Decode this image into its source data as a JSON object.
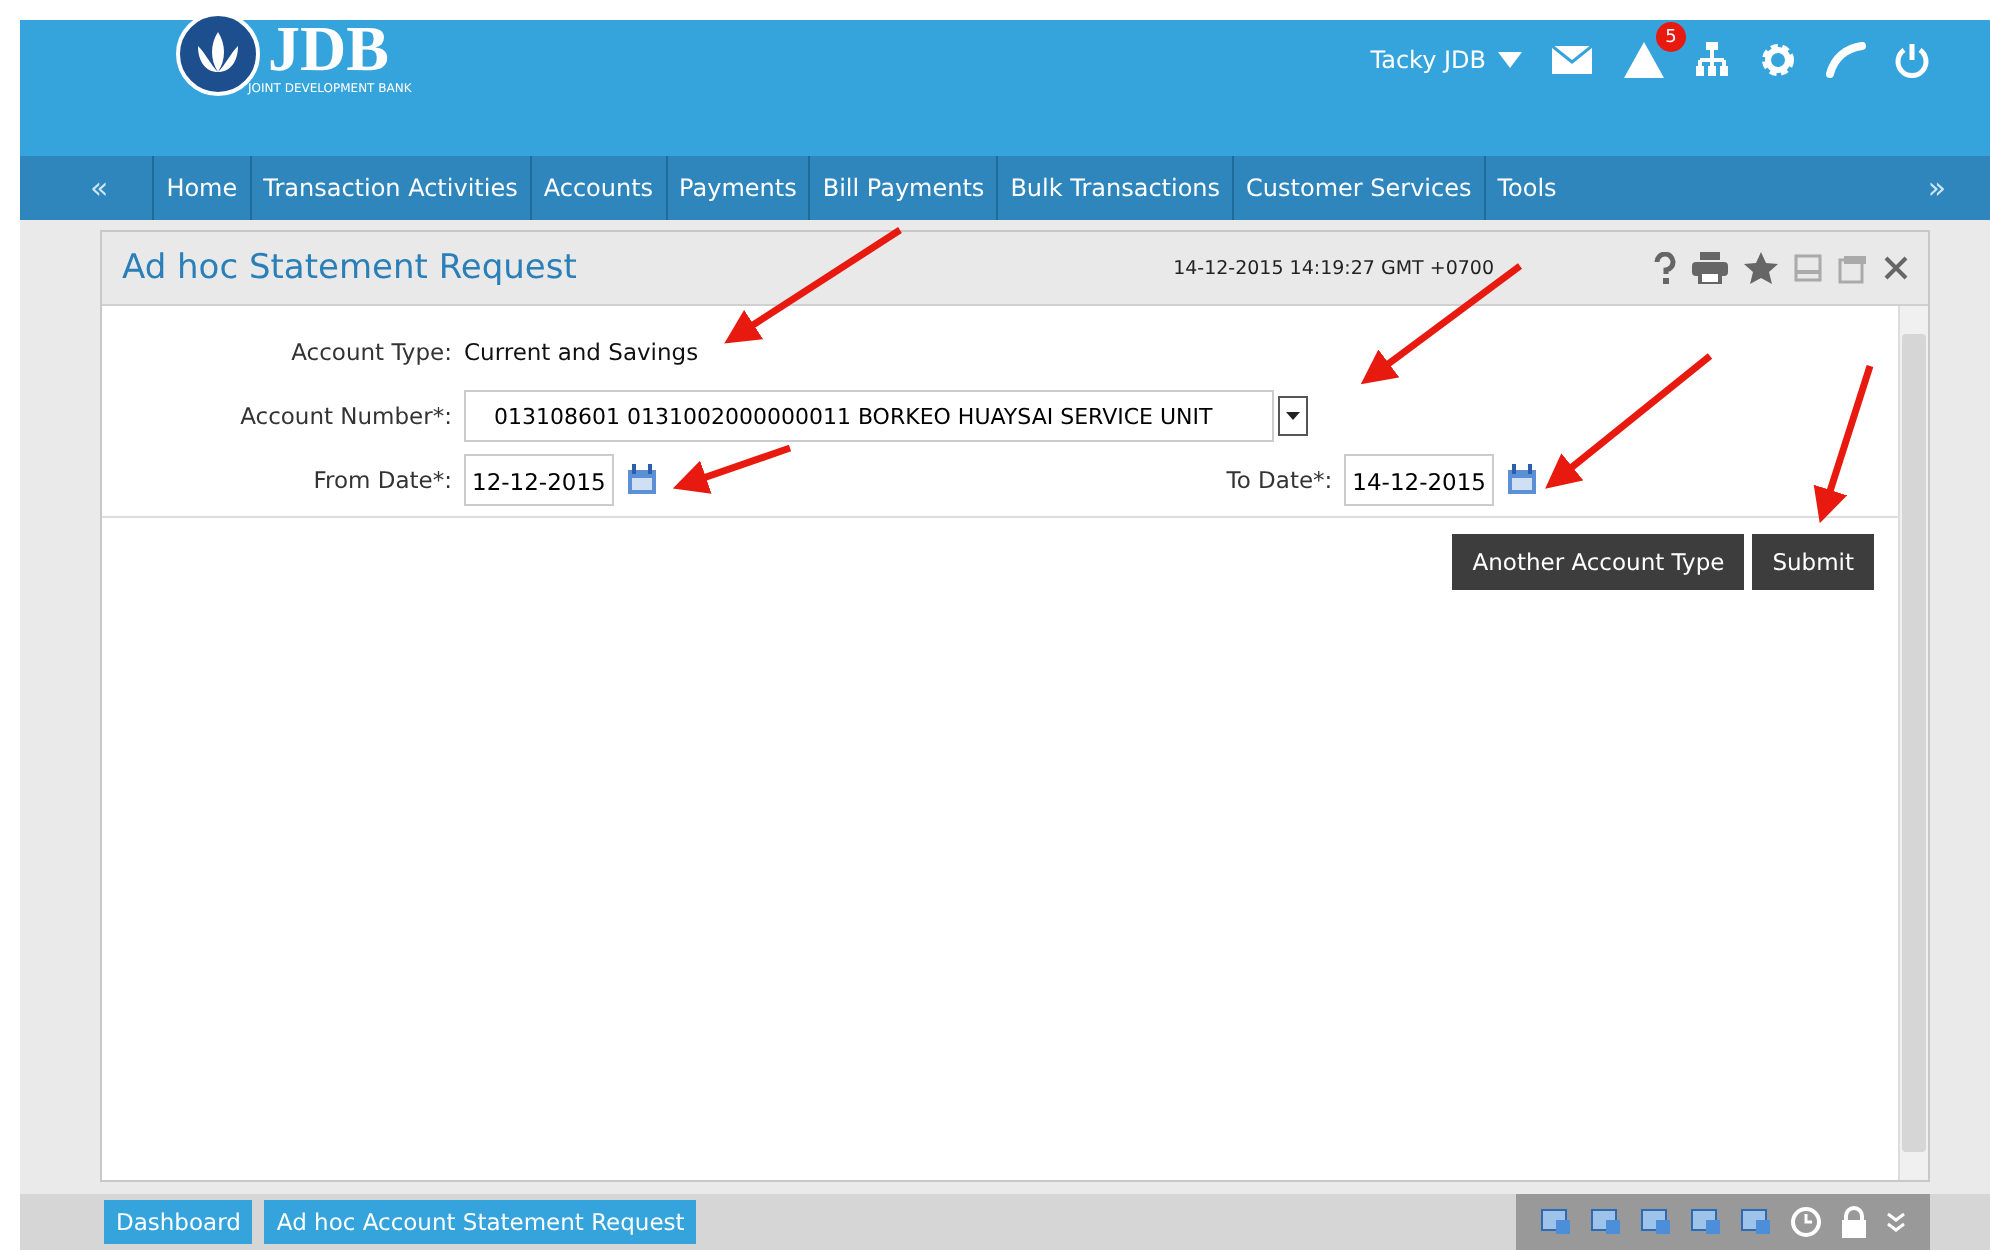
{
  "header": {
    "logo_text": "JDB",
    "logo_subtitle": "JOINT DEVELOPMENT BANK",
    "user": "Tacky JDB",
    "alert_count": "5"
  },
  "nav": {
    "prev": "«",
    "next": "»",
    "items": [
      "Home",
      "Transaction Activities",
      "Accounts",
      "Payments",
      "Bill Payments",
      "Bulk Transactions",
      "Customer Services",
      "Tools"
    ]
  },
  "panel": {
    "title": "Ad hoc Statement Request",
    "timestamp": "14-12-2015 14:19:27 GMT +0700"
  },
  "form": {
    "account_type_label": "Account Type:",
    "account_type_value": "Current and Savings",
    "account_number_label": "Account Number*:",
    "account_number_value": "013108601 0131002000000011 BORKEO HUAYSAI SERVICE UNIT",
    "from_label": "From Date*:",
    "from_value": "12-12-2015",
    "to_label": "To Date*:",
    "to_value": "14-12-2015"
  },
  "buttons": [
    "Another Account Type",
    "Submit"
  ],
  "taskbar": [
    "Dashboard",
    "Ad hoc Account Statement Request"
  ]
}
